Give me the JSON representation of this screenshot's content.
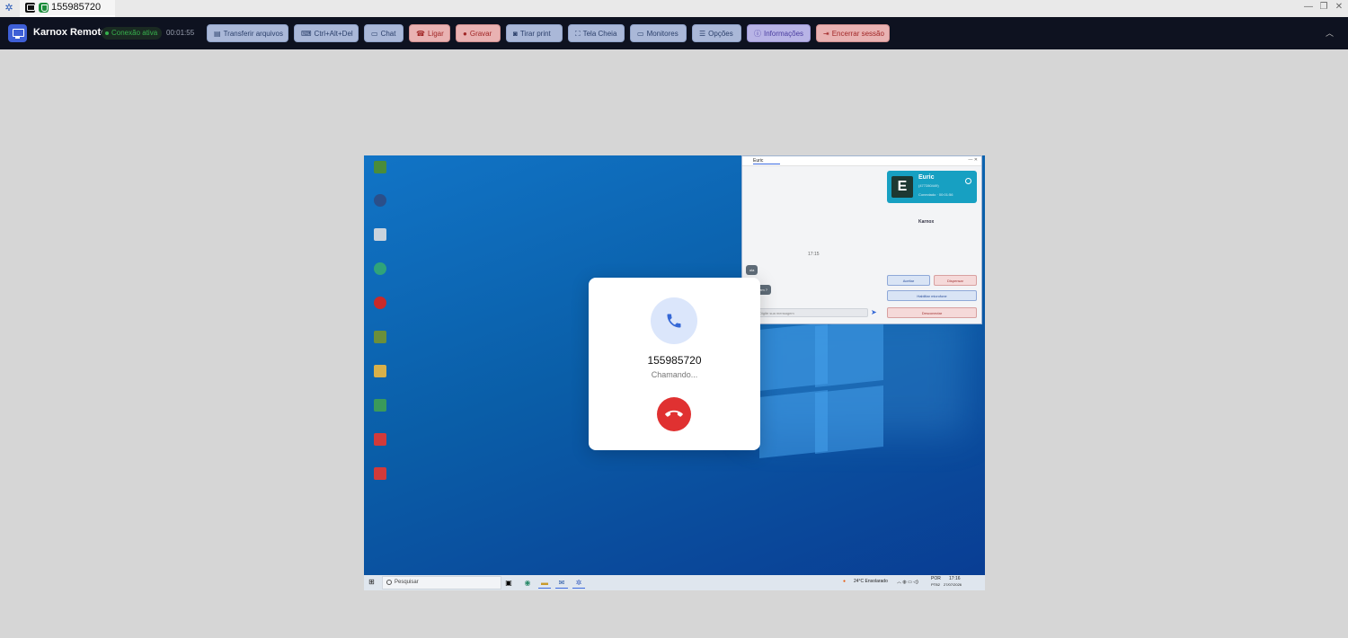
{
  "window": {
    "tab_title": "155985720"
  },
  "toolbar": {
    "brand": "Karnox Remoto",
    "status": "Conexão ativa",
    "timer": "00:01:55",
    "buttons": {
      "transfer": "Transferir arquivos",
      "ctrlaltdel": "Ctrl+Alt+Del",
      "chat": "Chat",
      "call": "Ligar",
      "record": "Gravar",
      "screenshot": "Tirar print",
      "fullscreen": "Tela Cheia",
      "monitors": "Monitores",
      "options": "Opções",
      "info": "Informações",
      "end": "Encerrar sessão"
    }
  },
  "remote": {
    "chat_window": {
      "tab": "Euric",
      "contact_name": "Euric",
      "contact_id": "(477280449)",
      "contact_status": "Conectado · 00:01:56",
      "logo_text": "Karnox",
      "timestamp": "17:15",
      "messages": [
        "ola",
        "tudo bem ?"
      ],
      "accept": "Aceitar",
      "dismiss": "Dispensar",
      "mic": "Habilitar microfone",
      "disconnect": "Desconectar",
      "input_placeholder": "Digite sua mensagem"
    },
    "taskbar": {
      "search": "Pesquisar",
      "weather": "24°C  Ensolarado",
      "lang": "POR",
      "lang_sub": "PTB2",
      "time": "17:16",
      "date": "27/07/2026"
    }
  },
  "call_dialog": {
    "number": "155985720",
    "state": "Chamando..."
  },
  "colors": {
    "toolbar_bg": "#0e1220",
    "accent": "#3e5fd6",
    "hangup": "#e03131",
    "phone_circle": "#dbe6fb"
  }
}
